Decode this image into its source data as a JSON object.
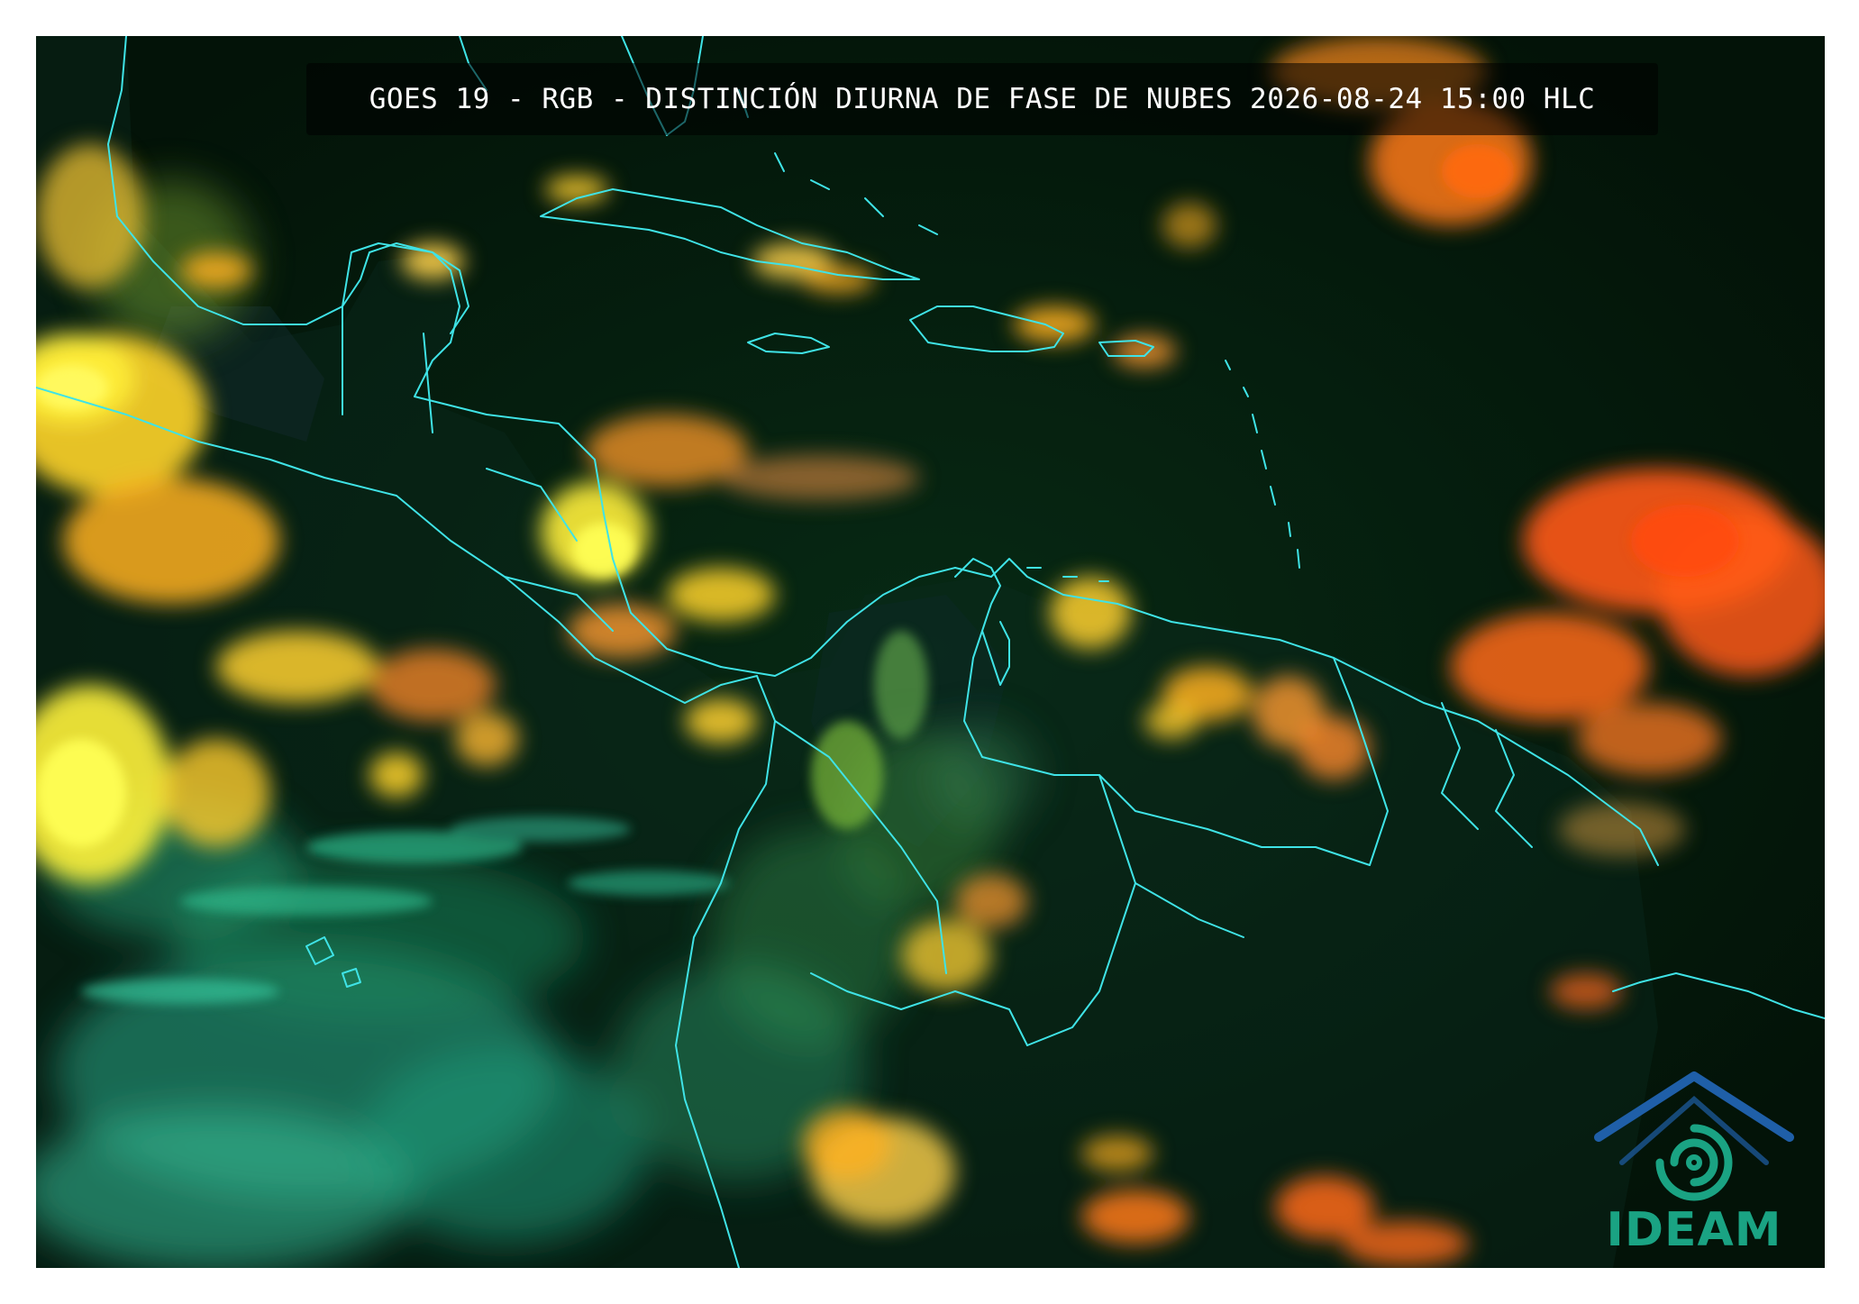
{
  "title": "GOES 19 - RGB - DISTINCIÓN DIURNA DE FASE DE NUBES 2026-08-24 15:00 HLC",
  "logo": {
    "text": "IDEAM",
    "text_color": "#1aa383",
    "roof_color": "#1f5fa8",
    "swirl_color": "#1aa383"
  },
  "colors": {
    "background": "#041a0b",
    "coastline": "#3fe3e6",
    "ice_cloud": "#ff6a1a",
    "mixed_cloud": "#ffb020",
    "deep_convection": "#ffe81a",
    "water_cloud": "#2fb88a",
    "low_cloud": "#1d8a6a"
  }
}
